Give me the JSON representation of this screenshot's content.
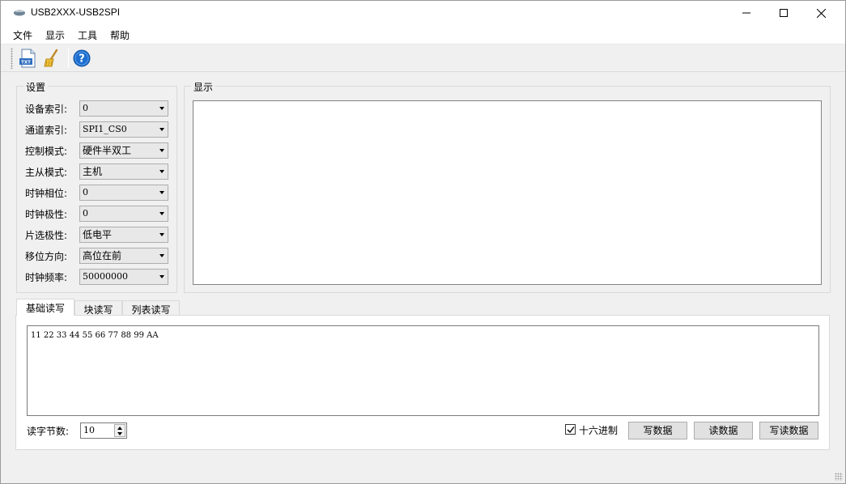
{
  "window": {
    "title": "USB2XXX-USB2SPI"
  },
  "menu": [
    "文件",
    "显示",
    "工具",
    "帮助"
  ],
  "toolbar": {
    "buttons": [
      "txt-file-icon",
      "broom-icon",
      "help-icon"
    ]
  },
  "settings": {
    "title": "设置",
    "fields": [
      {
        "label": "设备索引:",
        "value": "0"
      },
      {
        "label": "通道索引:",
        "value": "SPI1_CS0"
      },
      {
        "label": "控制模式:",
        "value": "硬件半双工"
      },
      {
        "label": "主从模式:",
        "value": "主机"
      },
      {
        "label": "时钟相位:",
        "value": "0"
      },
      {
        "label": "时钟极性:",
        "value": "0"
      },
      {
        "label": "片选极性:",
        "value": "低电平"
      },
      {
        "label": "移位方向:",
        "value": "高位在前"
      },
      {
        "label": "时钟频率:",
        "value": "50000000"
      }
    ]
  },
  "display": {
    "title": "显示",
    "content": ""
  },
  "tabs": [
    "基础读写",
    "块读写",
    "列表读写"
  ],
  "basic": {
    "data": "11 22 33 44 55 66 77 88 99 AA",
    "read_bytes_label": "读字节数:",
    "read_bytes_value": "10",
    "hex_label": "十六进制",
    "hex_checked": true,
    "write_button": "写数据",
    "read_button": "读数据",
    "write_read_button": "写读数据"
  },
  "colors": {
    "help_icon": "#1e6fd0",
    "window_bg": "#f0f0f0"
  }
}
